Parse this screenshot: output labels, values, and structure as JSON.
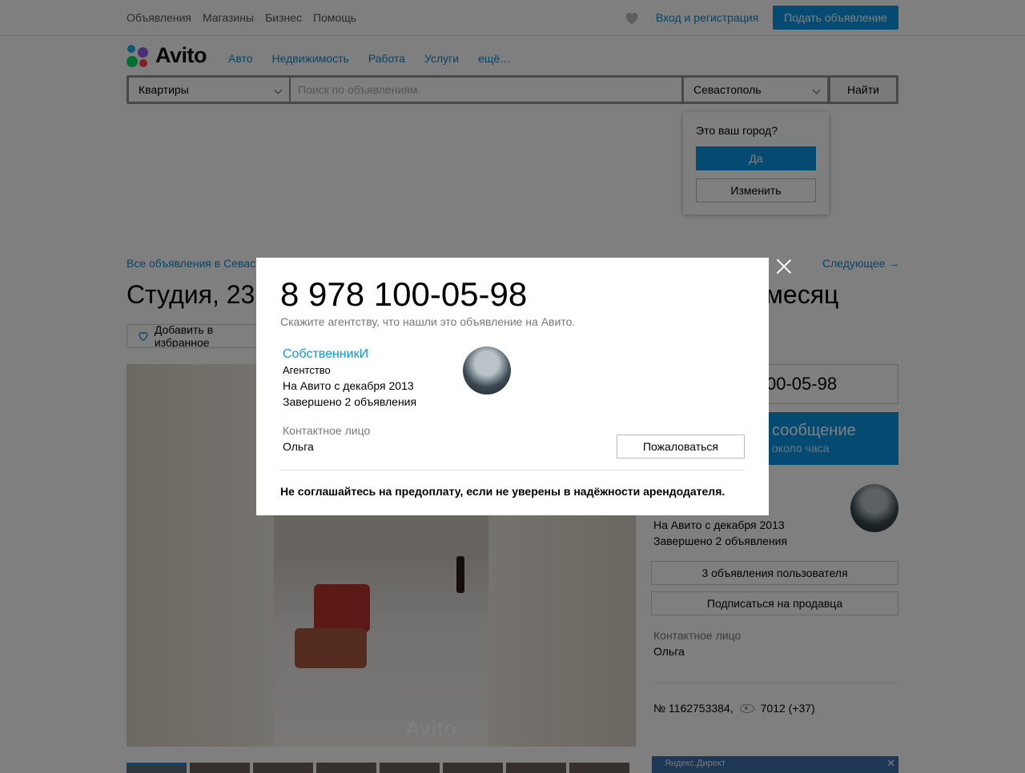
{
  "topbar": {
    "nav": [
      "Объявления",
      "Магазины",
      "Бизнес",
      "Помощь"
    ],
    "login": "Вход и регистрация",
    "post_ad": "Подать объявление"
  },
  "logo": {
    "text": "Avito"
  },
  "catnav": [
    "Авто",
    "Недвижимость",
    "Работа",
    "Услуги",
    "ещё…"
  ],
  "search": {
    "category": "Квартиры",
    "placeholder": "Поиск по объявлениям",
    "city": "Севастополь",
    "button": "Найти"
  },
  "city_popup": {
    "question": "Это ваш город?",
    "yes": "Да",
    "change": "Изменить"
  },
  "listing": {
    "breadcrumb": "Все объявления в Севас",
    "next": "Следующее →",
    "title": "Студия, 23",
    "price": "в месяц",
    "favorite": "Добавить в избранное",
    "watermark": "Avito"
  },
  "sidebar": {
    "phone": "00-05-98",
    "message_title": "сообщение",
    "message_sub": "около часа",
    "since": "На Авито с декабря 2013",
    "completed": "Завершено 2 объявления",
    "user_ads": "3 объявления пользователя",
    "subscribe": "Подписаться на продавца",
    "contact_label": "Контактное лицо",
    "contact_name": "Ольга",
    "ad_number": "№ 1162753384,",
    "views": "7012 (+37)",
    "ad_label": "Яндекс.Директ"
  },
  "modal": {
    "phone": "8 978 100-05-98",
    "hint": "Скажите агентству, что нашли это объявление на Авито.",
    "seller_name": "СобственникИ",
    "seller_type": "Агентство",
    "since": "На Авито с декабря 2013",
    "completed": "Завершено 2 объявления",
    "contact_label": "Контактное лицо",
    "contact_name": "Ольга",
    "report": "Пожаловаться",
    "warning": "Не соглашайтесь на предоплату, если не уверены в надёжности арендодателя."
  },
  "colors": {
    "accent": "#0a97e3",
    "link": "#0a8bd0"
  }
}
